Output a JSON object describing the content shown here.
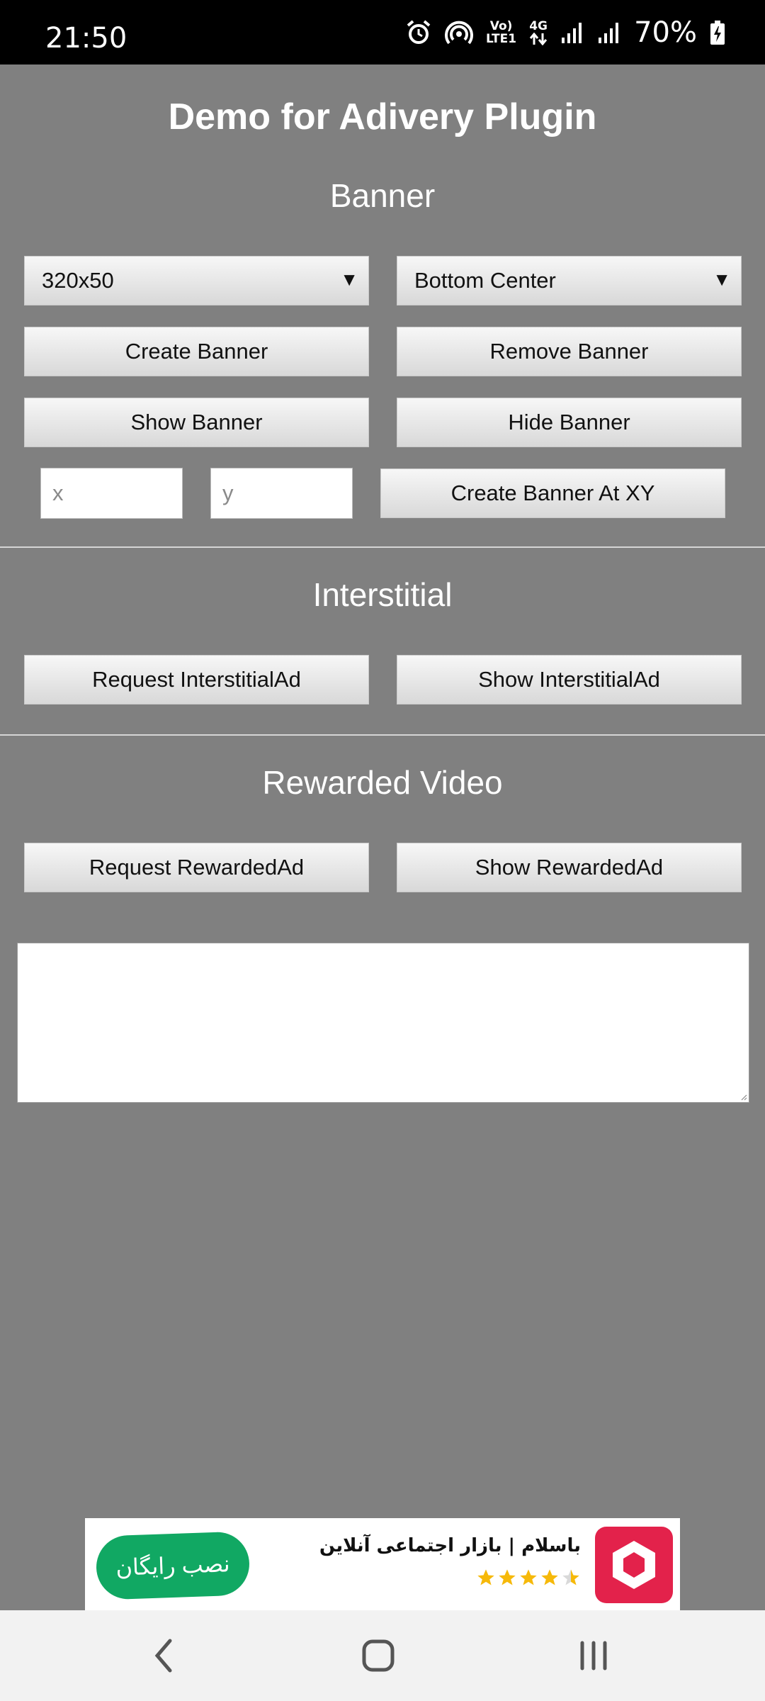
{
  "status_bar": {
    "time": "21:50",
    "net_label_top": "Vo)",
    "net_label_bottom": "LTE1",
    "net_type": "4G",
    "battery": "70%",
    "icons": [
      "alarm-icon",
      "hotspot-icon",
      "volte-icon",
      "data-arrows-icon",
      "signal-icon",
      "signal-icon",
      "battery-charging-icon"
    ]
  },
  "title": "Demo for Adivery Plugin",
  "banner": {
    "heading": "Banner",
    "size_select": "320x50",
    "position_select": "Bottom Center",
    "create_label": "Create Banner",
    "remove_label": "Remove Banner",
    "show_label": "Show Banner",
    "hide_label": "Hide Banner",
    "x_placeholder": "x",
    "y_placeholder": "y",
    "create_xy_label": "Create Banner At XY"
  },
  "interstitial": {
    "heading": "Interstitial",
    "request_label": "Request InterstitialAd",
    "show_label": "Show InterstitialAd"
  },
  "rewarded": {
    "heading": "Rewarded Video",
    "request_label": "Request RewardedAd",
    "show_label": "Show RewardedAd"
  },
  "log": {
    "value": ""
  },
  "ad": {
    "install_label": "نصب رایگان",
    "title": "باسلام | بازار اجتماعی آنلاین",
    "rating_stars": 4.5,
    "brand_color": "#e3224b",
    "install_color": "#11a863"
  },
  "nav": {
    "icons": [
      "back-icon",
      "home-icon",
      "recents-icon"
    ]
  }
}
